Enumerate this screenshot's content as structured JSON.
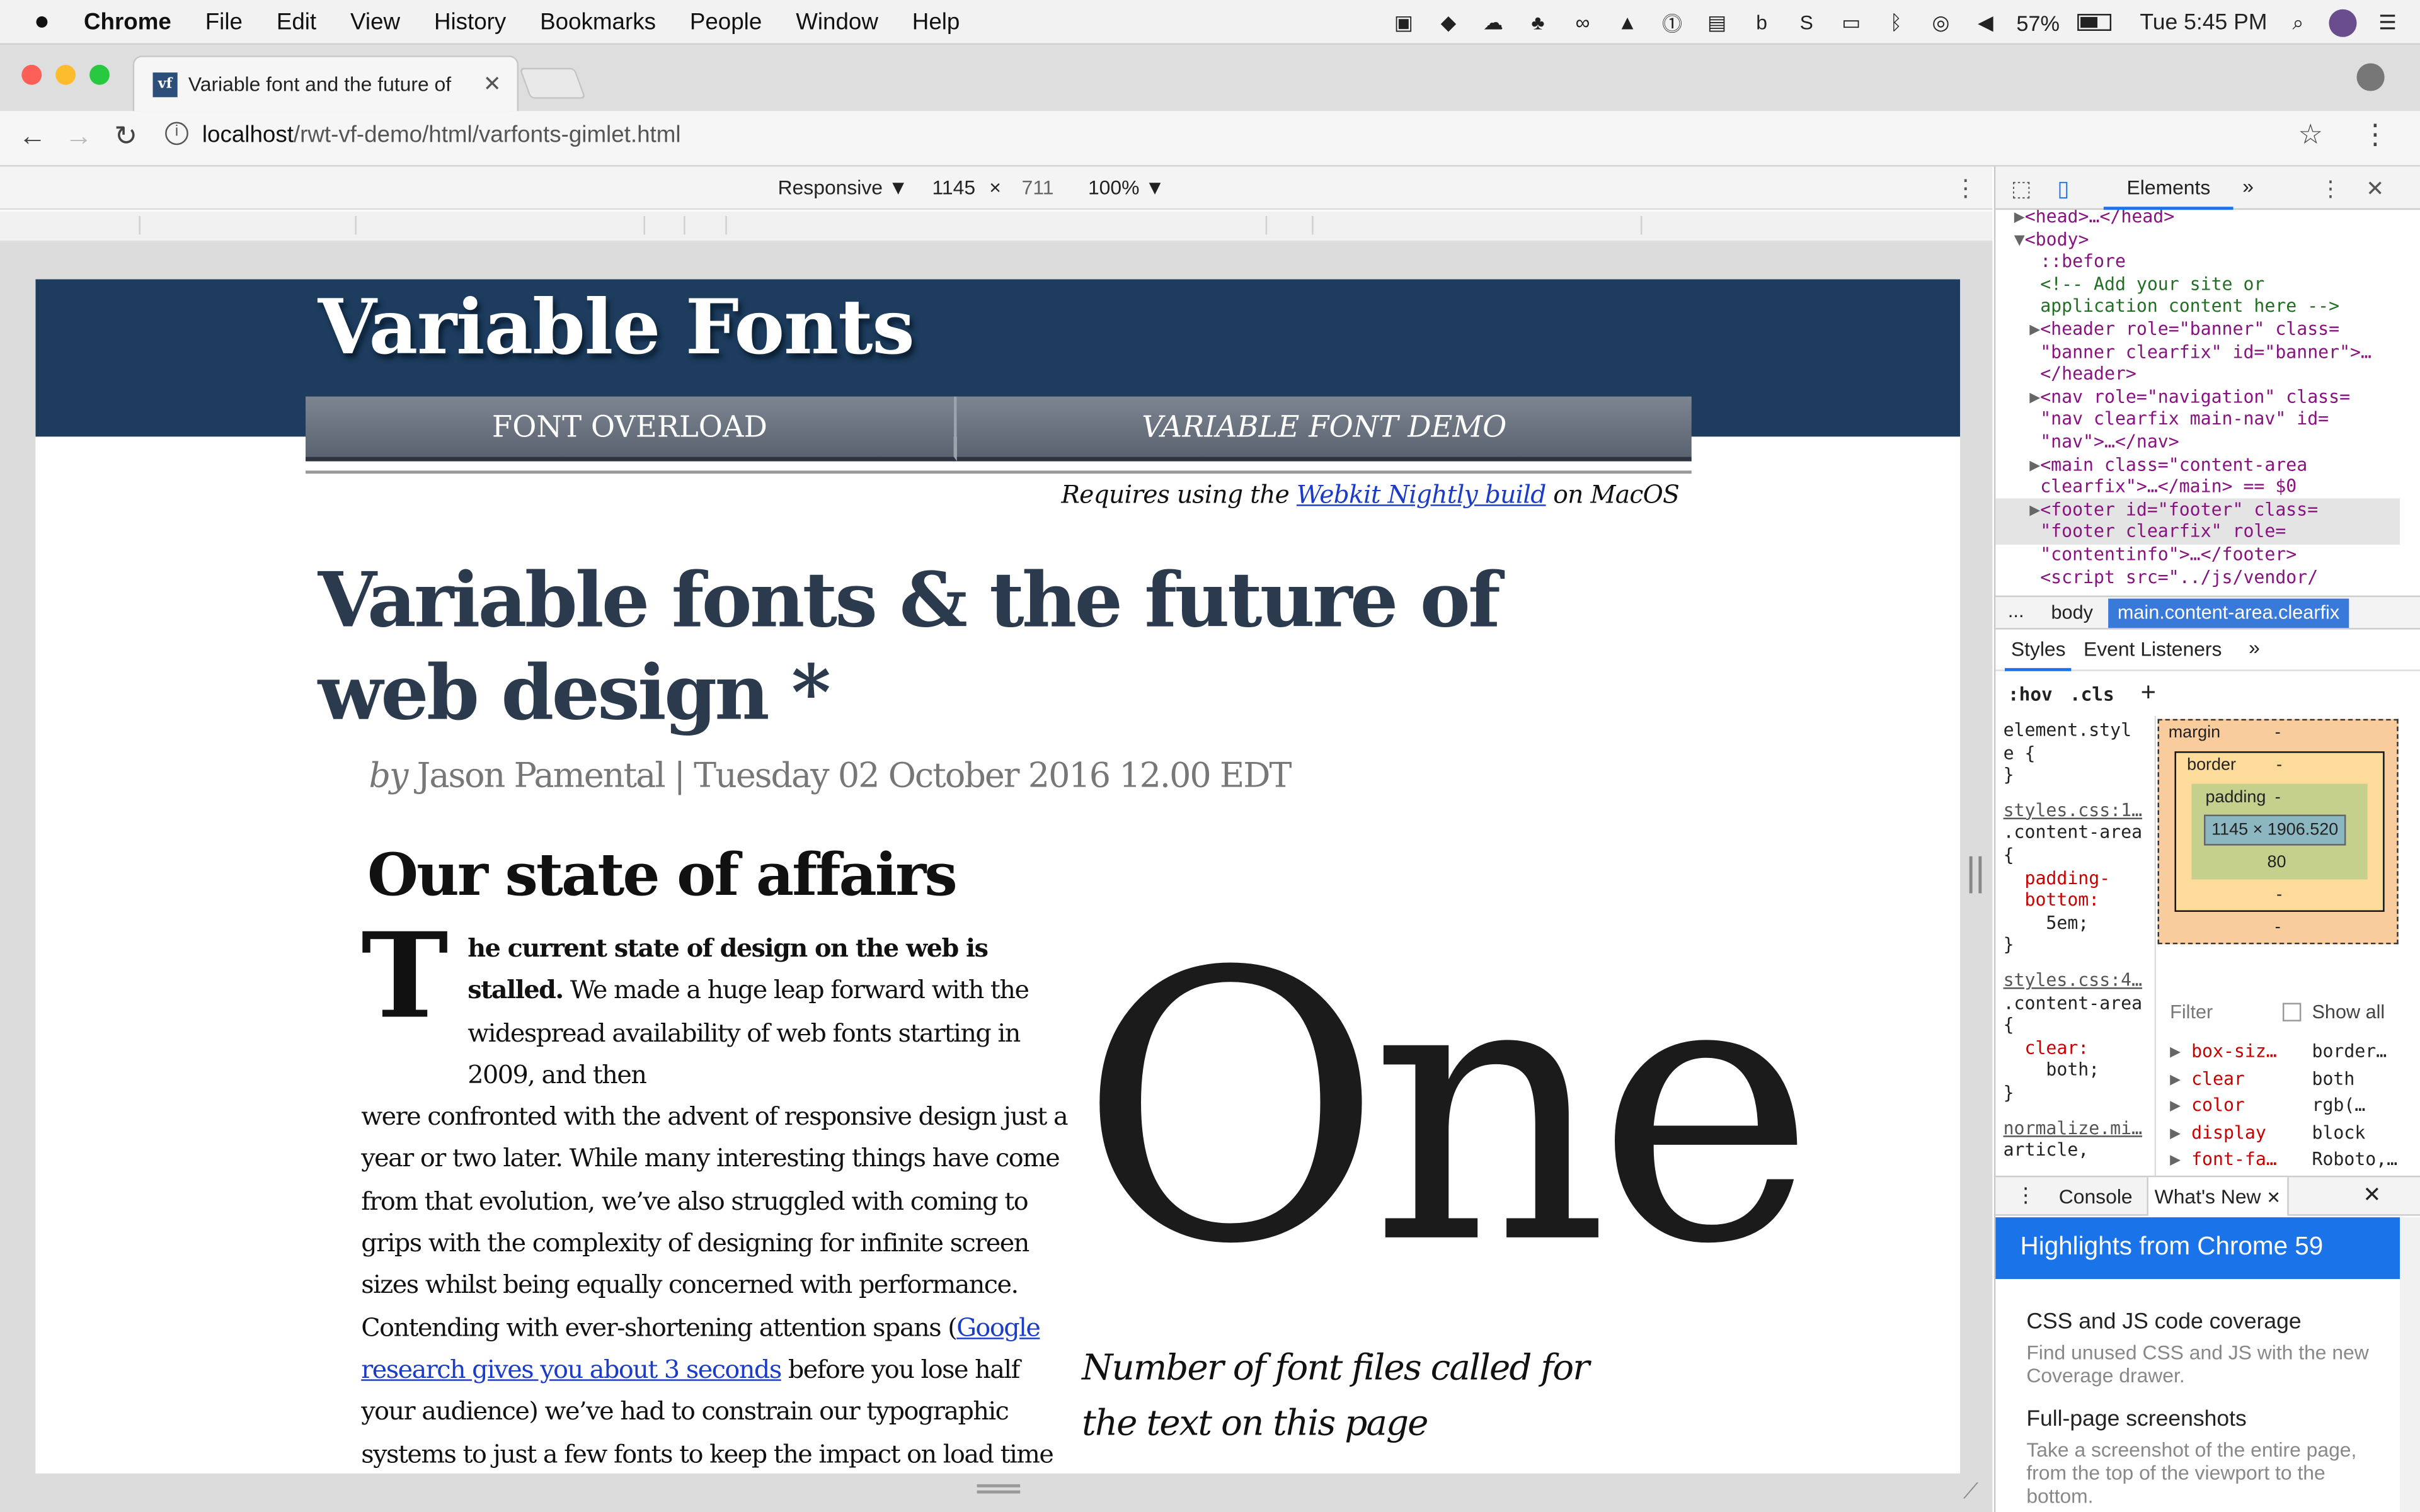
{
  "menubar": {
    "apple": "",
    "app": "Chrome",
    "items": [
      "File",
      "Edit",
      "View",
      "History",
      "Bookmarks",
      "People",
      "Window",
      "Help"
    ],
    "battery": "57%",
    "clock": "Tue 5:45 PM"
  },
  "browser": {
    "tab_title": "Variable font and the future of",
    "favicon": "vf",
    "url_host": "localhost",
    "url_path": "/rwt-vf-demo/html/varfonts-gimlet.html"
  },
  "device_toolbar": {
    "mode": "Responsive ▼",
    "width": "1145",
    "times": "×",
    "height": "711",
    "zoom": "100% ▼"
  },
  "page": {
    "site_title": "Variable Fonts",
    "nav": [
      "FONT OVERLOAD",
      "VARIABLE FONT DEMO"
    ],
    "requires_prefix": "Requires using the ",
    "requires_link": "Webkit Nightly build",
    "requires_suffix": " on MacOS",
    "headline": "Variable fonts & the future of web design *",
    "byline_by": "by",
    "byline_rest": " Jason Pamental | Tuesday 02 October 2016 12.00 EDT",
    "section_heading": "Our state of affairs",
    "dropcap": "T",
    "para_lead": "he current state of design on the web is stalled.",
    "para_1": "We made a huge leap forward with the widespread availability of web fonts starting in 2009, and then",
    "para_2": "were confronted with the advent of responsive design just a year or two later. While many interesting things have come from that evolution, we’ve also struggled with coming to grips with the complexity of designing for infinite screen sizes whilst being equally concerned with performance. Contending with ever-shortening attention spans (",
    "para_link": "Google research gives you about 3 seconds",
    "para_3": " before you lose half your audience) we’ve had to constrain our typographic systems to just a few fonts to keep the impact on load time to a minimum.",
    "big_number": "One",
    "caption": "Number of font files called for the text on this page"
  },
  "devtools": {
    "tab_elements": "Elements",
    "more": "»",
    "dom": [
      {
        "indent": 1,
        "arrow": "▶",
        "html": "<head>…</head>"
      },
      {
        "indent": 1,
        "arrow": "▼",
        "html": "<body>"
      },
      {
        "indent": 2,
        "arrow": "",
        "html": "::before"
      },
      {
        "indent": 2,
        "arrow": "",
        "html": "<!-- Add your site or"
      },
      {
        "indent": 2,
        "arrow": "",
        "html": "application content here -->"
      },
      {
        "indent": 2,
        "arrow": "▶",
        "html": "<header role=\"banner\" class="
      },
      {
        "indent": 2,
        "arrow": "",
        "html": "\"banner clearfix\" id=\"banner\">…"
      },
      {
        "indent": 2,
        "arrow": "",
        "html": "</header>"
      },
      {
        "indent": 2,
        "arrow": "▶",
        "html": "<nav role=\"navigation\" class="
      },
      {
        "indent": 2,
        "arrow": "",
        "html": "\"nav clearfix main-nav\" id="
      },
      {
        "indent": 2,
        "arrow": "",
        "html": "\"nav\">…</nav>"
      },
      {
        "indent": 2,
        "arrow": "▶",
        "html": "<main class=\"content-area"
      },
      {
        "indent": 2,
        "arrow": "",
        "html": "clearfix\">…</main> == $0"
      },
      {
        "indent": 2,
        "arrow": "▶",
        "html": "<footer id=\"footer\" class="
      },
      {
        "indent": 2,
        "arrow": "",
        "html": "\"footer clearfix\" role="
      },
      {
        "indent": 2,
        "arrow": "",
        "html": "\"contentinfo\">…</footer>"
      },
      {
        "indent": 2,
        "arrow": "",
        "html": "<script src=\"../js/vendor/"
      }
    ],
    "crumb_dots": "...",
    "crumb_body": "body",
    "crumb_selected": "main.content-area.clearfix",
    "styles_tab": "Styles",
    "listeners_tab": "Event Listeners",
    "hov": ":hov",
    "cls": ".cls",
    "plus": "+",
    "style_lines": [
      {
        "t": "element.styl",
        "k": "sel"
      },
      {
        "t": "e {",
        "k": "sel"
      },
      {
        "t": "}",
        "k": "sel"
      },
      {
        "t": "styles.css:1…",
        "k": "link"
      },
      {
        "t": ".content-area",
        "k": "sel"
      },
      {
        "t": "{",
        "k": "sel"
      },
      {
        "t": "  padding-",
        "k": "prop"
      },
      {
        "t": "  bottom:",
        "k": "prop"
      },
      {
        "t": "    5em;",
        "k": "val"
      },
      {
        "t": "}",
        "k": "sel"
      },
      {
        "t": "styles.css:4…",
        "k": "link"
      },
      {
        "t": ".content-area",
        "k": "sel"
      },
      {
        "t": "{",
        "k": "sel"
      },
      {
        "t": "  clear:",
        "k": "prop"
      },
      {
        "t": "    both;",
        "k": "val"
      },
      {
        "t": "}",
        "k": "sel"
      },
      {
        "t": "normalize.mi…",
        "k": "link"
      },
      {
        "t": "article,",
        "k": "sel"
      }
    ],
    "box_margin": "margin",
    "box_dash": "-",
    "box_border": "border",
    "box_padding": "padding",
    "box_content": "1145 × 1906.520",
    "box_bottom": "80",
    "filter": "Filter",
    "show_all": "Show all",
    "computed": [
      {
        "p": "box-siz…",
        "v": "border…"
      },
      {
        "p": "clear",
        "v": "both"
      },
      {
        "p": "color",
        "v": "rgb(…"
      },
      {
        "p": "display",
        "v": "block"
      },
      {
        "p": "font-fa…",
        "v": "Roboto,…"
      }
    ],
    "console_tab": "Console",
    "whats_new_tab": "What's New",
    "whats_new_banner": "Highlights from Chrome 59",
    "news": [
      {
        "h": "CSS and JS code coverage",
        "p": "Find unused CSS and JS with the new Coverage drawer."
      },
      {
        "h": "Full-page screenshots",
        "p": "Take a screenshot of the entire page, from the top of the viewport to the bottom."
      }
    ]
  }
}
